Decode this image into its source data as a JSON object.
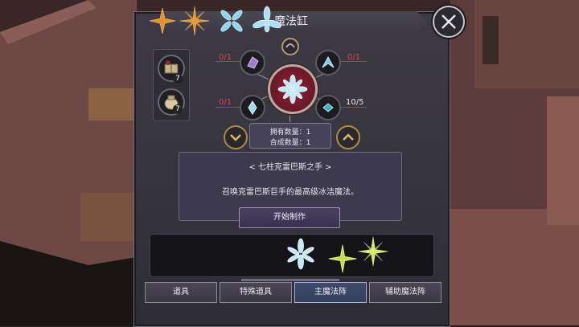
{
  "window": {
    "title": "魔法缸"
  },
  "ingredients": [
    {
      "icon": "book-ingredient-icon",
      "count": "7"
    },
    {
      "icon": "jar-ingredient-icon",
      "count": "7"
    }
  ],
  "materials": [
    {
      "icon": "purple-crystal-icon",
      "count": "0/1",
      "status": "red"
    },
    {
      "icon": "blue-wing-icon",
      "count": "0/1",
      "status": "red"
    },
    {
      "icon": "ice-shard-icon",
      "count": "0/1",
      "status": "red"
    },
    {
      "icon": "teal-gem-icon",
      "count": "10/5",
      "status": "white"
    }
  ],
  "quantity": {
    "owned_label": "拥有数量：1",
    "craft_label": "合成数量：1"
  },
  "recipe": {
    "name": "< 七柱克雷巴斯之手 >",
    "description": "召唤克雷巴斯巨手的最高级冰洁魔法。",
    "start_label": "开始制作"
  },
  "spells": [
    {
      "icon": "fire-star-spell-icon",
      "color": "#e8902a"
    },
    {
      "icon": "fire-cross-spell-icon",
      "color": "#e8902a"
    },
    {
      "icon": "ice-flower-spell-icon",
      "color": "#8fd4f0"
    },
    {
      "icon": "ice-lotus-spell-icon",
      "color": "#a8e0f5"
    },
    {
      "icon": "ice-crystal-spell-icon",
      "color": "#c0ecfa",
      "selected": true
    },
    {
      "icon": "wind-spark-spell-icon",
      "color": "#c8dc50"
    },
    {
      "icon": "wind-star-spell-icon",
      "color": "#d6e86a"
    }
  ],
  "tabs": [
    {
      "label": "道具",
      "active": false
    },
    {
      "label": "特殊道具",
      "active": false
    },
    {
      "label": "主魔法阵",
      "active": true
    },
    {
      "label": "辅助魔法阵",
      "active": false
    }
  ]
}
